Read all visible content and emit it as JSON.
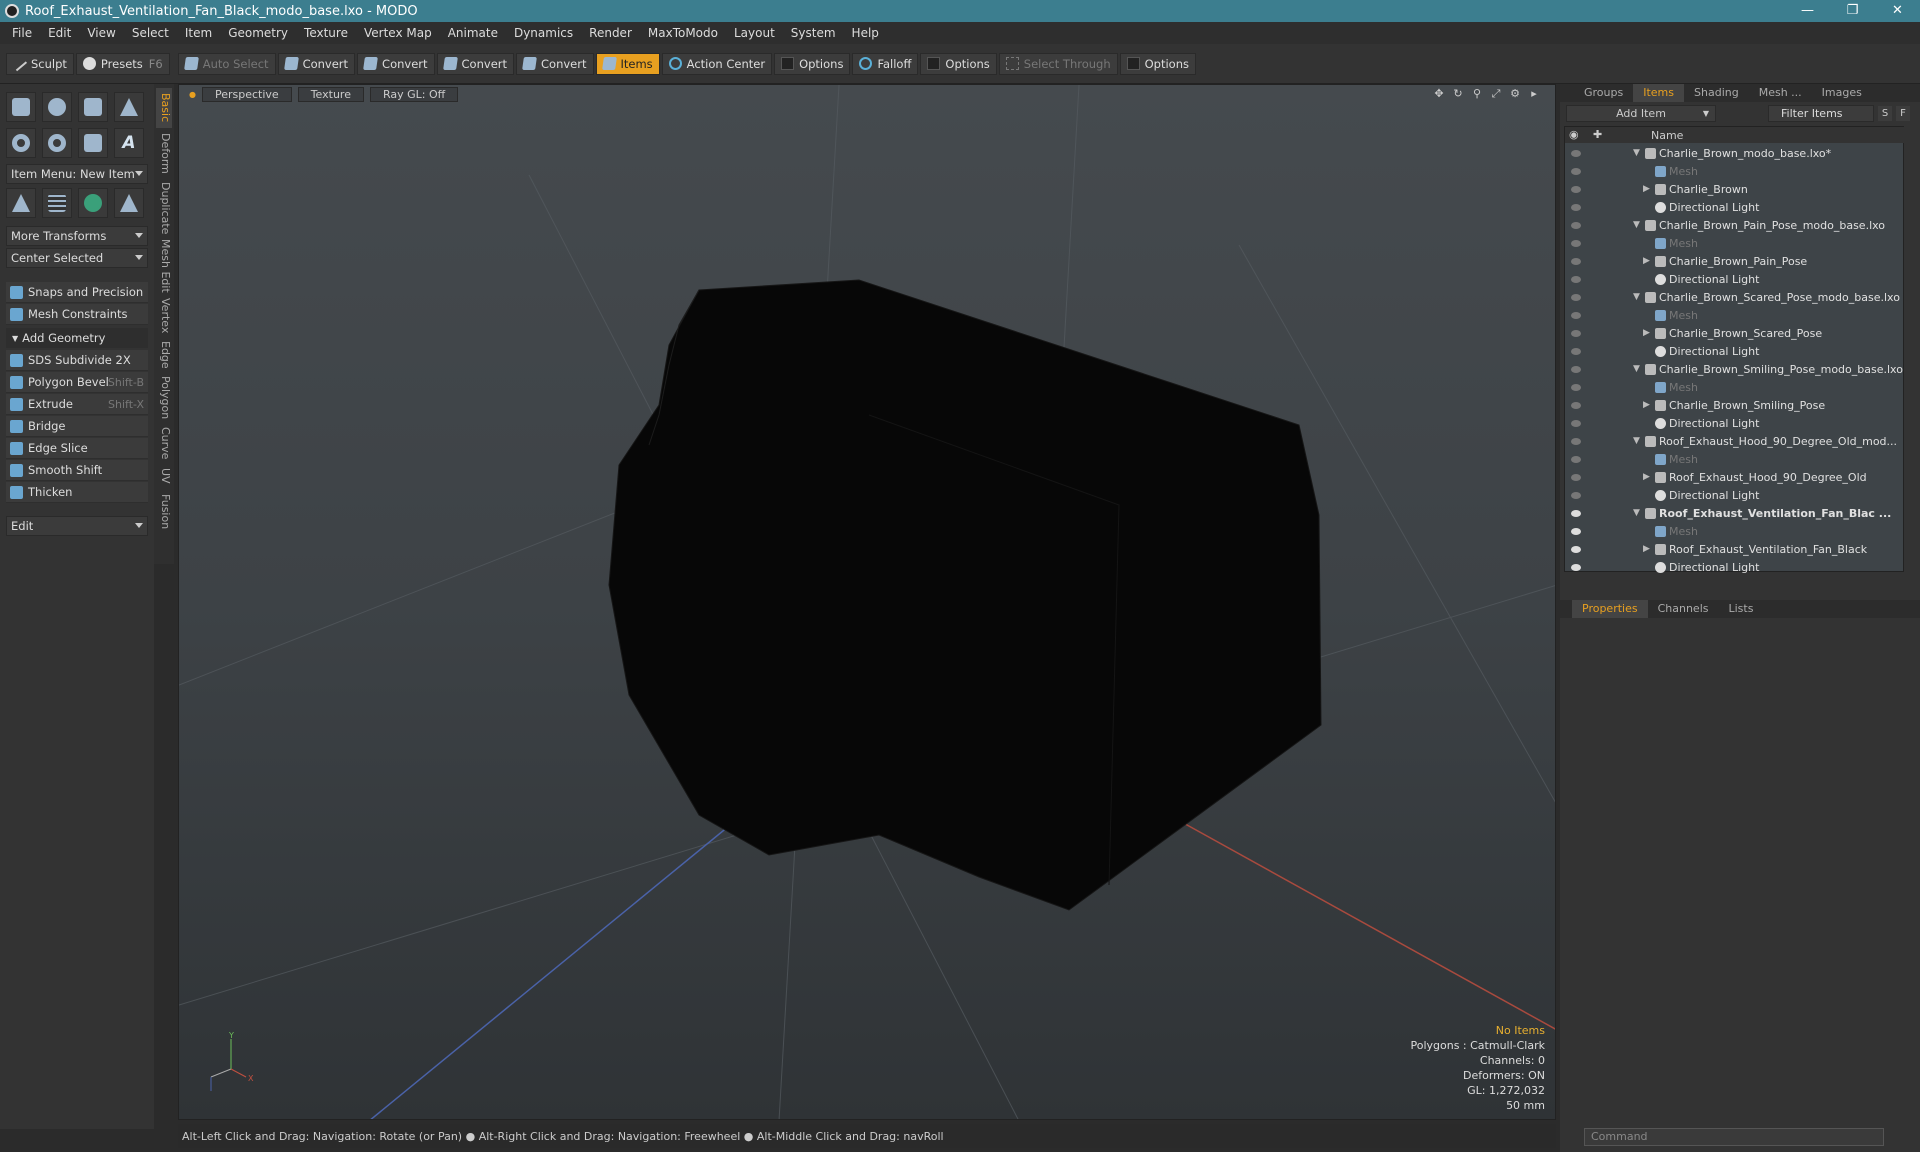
{
  "window": {
    "title": "Roof_Exhaust_Ventilation_Fan_Black_modo_base.lxo - MODO",
    "min": "—",
    "max": "❐",
    "close": "✕"
  },
  "menu": [
    "File",
    "Edit",
    "View",
    "Select",
    "Item",
    "Geometry",
    "Texture",
    "Vertex Map",
    "Animate",
    "Dynamics",
    "Render",
    "MaxToModo",
    "Layout",
    "System",
    "Help"
  ],
  "toolbar": {
    "sculpt": "Sculpt",
    "presets": "Presets",
    "presets_key": "F6",
    "auto_select": "Auto Select",
    "convert1": "Convert",
    "convert2": "Convert",
    "convert3": "Convert",
    "convert4": "Convert",
    "items": "Items",
    "action_center": "Action Center",
    "options1": "Options",
    "falloff": "Falloff",
    "options2": "Options",
    "select_through": "Select Through",
    "options3": "Options"
  },
  "left": {
    "item_menu": "Item Menu: New Item",
    "more_transforms": "More Transforms",
    "center_selected": "Center Selected",
    "snaps": "Snaps and Precision",
    "mesh_constraints": "Mesh Constraints",
    "add_geometry": "Add Geometry",
    "tools": [
      {
        "label": "SDS Subdivide 2X",
        "key": ""
      },
      {
        "label": "Polygon Bevel",
        "key": "Shift-B"
      },
      {
        "label": "Extrude",
        "key": "Shift-X"
      },
      {
        "label": "Bridge",
        "key": ""
      },
      {
        "label": "Edge Slice",
        "key": ""
      },
      {
        "label": "Smooth Shift",
        "key": ""
      },
      {
        "label": "Thicken",
        "key": ""
      }
    ],
    "edit": "Edit"
  },
  "vtabs": [
    "Basic",
    "Deform",
    "Duplicate",
    "Mesh Edit",
    "Vertex",
    "Edge",
    "Polygon",
    "Curve",
    "UV",
    "Fusion"
  ],
  "viewport": {
    "perspective": "Perspective",
    "texture": "Texture",
    "raygl": "Ray GL: Off",
    "info": {
      "no_items": "No Items",
      "polygons": "Polygons : Catmull-Clark",
      "channels": "Channels: 0",
      "deformers": "Deformers: ON",
      "gl": "GL: 1,272,032",
      "focal": "50 mm"
    }
  },
  "status": "Alt-Left Click and Drag: Navigation: Rotate (or Pan) ● Alt-Right Click and Drag: Navigation: Freewheel ● Alt-Middle Click and Drag: navRoll",
  "right": {
    "tabs": [
      "Groups",
      "Items",
      "Shading",
      "Mesh ...",
      "Images"
    ],
    "add_item": "Add Item",
    "filter_items": "Filter Items",
    "s": "S",
    "f": "F",
    "name_col": "Name",
    "items": [
      {
        "label": "Charlie_Brown_modo_base.lxo*",
        "kind": "scene"
      },
      {
        "label": "Mesh",
        "kind": "mesh"
      },
      {
        "label": "Charlie_Brown",
        "kind": "item"
      },
      {
        "label": "Directional Light",
        "kind": "light"
      },
      {
        "label": "Charlie_Brown_Pain_Pose_modo_base.lxo",
        "kind": "scene"
      },
      {
        "label": "Mesh",
        "kind": "mesh"
      },
      {
        "label": "Charlie_Brown_Pain_Pose",
        "kind": "item"
      },
      {
        "label": "Directional Light",
        "kind": "light"
      },
      {
        "label": "Charlie_Brown_Scared_Pose_modo_base.lxo",
        "kind": "scene"
      },
      {
        "label": "Mesh",
        "kind": "mesh"
      },
      {
        "label": "Charlie_Brown_Scared_Pose",
        "kind": "item"
      },
      {
        "label": "Directional Light",
        "kind": "light"
      },
      {
        "label": "Charlie_Brown_Smiling_Pose_modo_base.lxo",
        "kind": "scene"
      },
      {
        "label": "Mesh",
        "kind": "mesh"
      },
      {
        "label": "Charlie_Brown_Smiling_Pose",
        "kind": "item"
      },
      {
        "label": "Directional Light",
        "kind": "light"
      },
      {
        "label": "Roof_Exhaust_Hood_90_Degree_Old_mod...",
        "kind": "scene"
      },
      {
        "label": "Mesh",
        "kind": "mesh"
      },
      {
        "label": "Roof_Exhaust_Hood_90_Degree_Old",
        "kind": "item"
      },
      {
        "label": "Directional Light",
        "kind": "light"
      },
      {
        "label": "Roof_Exhaust_Ventilation_Fan_Blac ...",
        "kind": "scene-active"
      },
      {
        "label": "Mesh",
        "kind": "mesh"
      },
      {
        "label": "Roof_Exhaust_Ventilation_Fan_Black",
        "kind": "item"
      },
      {
        "label": "Directional Light",
        "kind": "light"
      }
    ],
    "prop_tabs": [
      "Properties",
      "Channels",
      "Lists"
    ],
    "command_placeholder": "Command"
  },
  "colors": {
    "accent": "#e8a020",
    "titlebar": "#3c7e8f"
  }
}
